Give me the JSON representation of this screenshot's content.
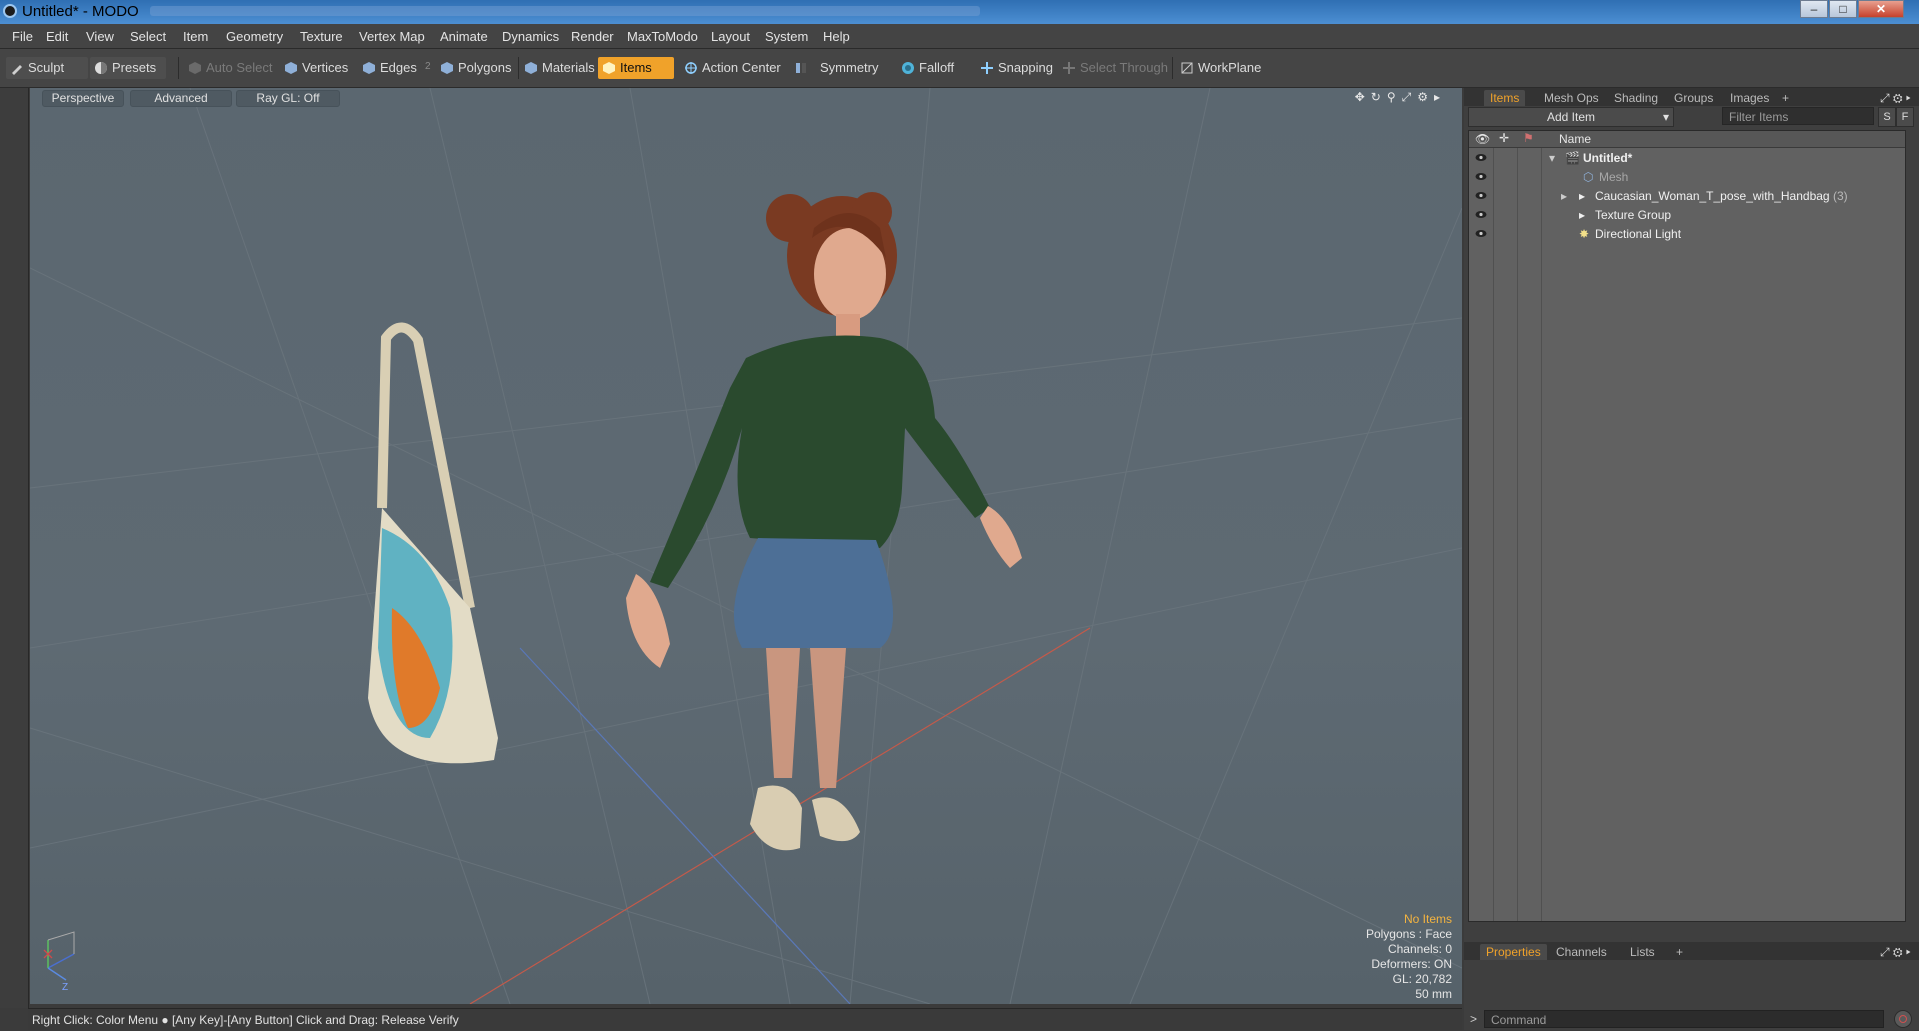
{
  "window": {
    "title": "Untitled* - MODO",
    "minimize": "–",
    "maximize": "□",
    "close": "✕"
  },
  "menu": [
    "File",
    "Edit",
    "View",
    "Select",
    "Item",
    "Geometry",
    "Texture",
    "Vertex Map",
    "Animate",
    "Dynamics",
    "Render",
    "MaxToModo",
    "Layout",
    "System",
    "Help"
  ],
  "toolbar": {
    "sculpt": "Sculpt",
    "presets": "Presets",
    "auto_select": "Auto Select",
    "vertices": "Vertices",
    "edges": "Edges",
    "edges_count": "2",
    "polygons": "Polygons",
    "materials": "Materials",
    "items": "Items",
    "action_center": "Action Center",
    "symmetry": "Symmetry",
    "falloff": "Falloff",
    "snapping": "Snapping",
    "select_through": "Select Through",
    "workplane": "WorkPlane"
  },
  "viewport": {
    "tabs": [
      "Perspective",
      "Advanced",
      "Ray GL: Off"
    ],
    "hud": {
      "selection": "No Items",
      "polygons": "Polygons : Face",
      "channels": "Channels: 0",
      "deformers": "Deformers: ON",
      "gl": "GL: 20,782",
      "lens": "50 mm"
    },
    "colors": {
      "accent": "#f0a22a",
      "background": "#5d6972"
    }
  },
  "status_bar": {
    "text": "Right Click: Color Menu ● [Any Key]-[Any Button] Click and Drag: Release Verify"
  },
  "right_panel": {
    "top_tabs": [
      "Items",
      "Mesh Ops",
      "Shading",
      "Groups",
      "Images",
      "+"
    ],
    "add_item": "Add Item",
    "filter_placeholder": "Filter Items",
    "s_btn": "S",
    "f_btn": "F",
    "name_header": "Name",
    "tree": [
      {
        "label": "Untitled*",
        "bold": true
      },
      {
        "label": "Mesh",
        "dim": true
      },
      {
        "label": "Caucasian_Woman_T_pose_with_Handbag",
        "count": "(3)"
      },
      {
        "label": "Texture Group"
      },
      {
        "label": "Directional Light"
      }
    ],
    "bottom_tabs": [
      "Properties",
      "Channels",
      "Lists",
      "+"
    ],
    "command_placeholder": "Command",
    "prompt": ">"
  }
}
